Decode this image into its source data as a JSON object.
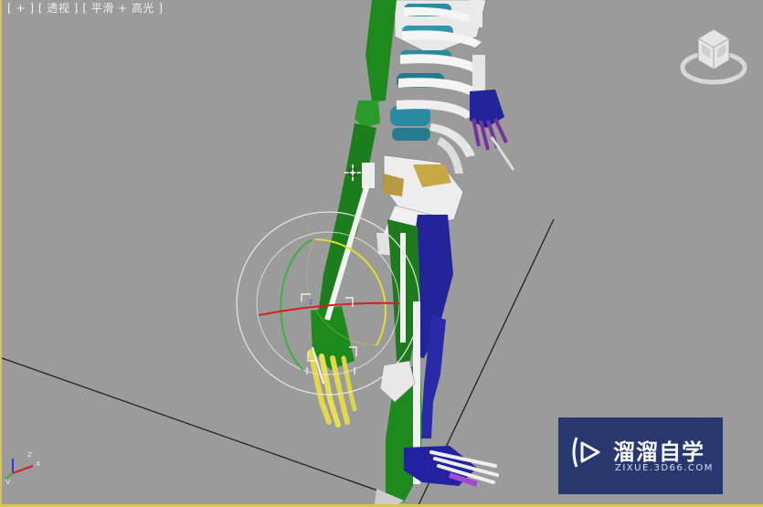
{
  "viewport": {
    "label_parts": [
      "[ + ]",
      "[ 透视 ]",
      "[ 平滑 + 高光 ]"
    ]
  },
  "axis_tripod": {
    "x": "x",
    "y": "y",
    "z": "z"
  },
  "rotate_gizmo": {
    "axis_label": "z"
  },
  "watermark": {
    "title": "溜溜自学",
    "url": "ZIXUE.3D66.COM"
  },
  "colors": {
    "viewport_bg": "#9b9b9b",
    "active_border": "#d8c64a",
    "arm_green": "#1e7d1e",
    "leg_blue": "#23239a",
    "bone_white": "#f2f2f2",
    "rib_teal": "#2a8aa0",
    "pelvis_gold": "#c8a845",
    "gizmo_red": "#d42020",
    "gizmo_yellow": "#e3dd32",
    "gizmo_green": "#3bb33b"
  }
}
